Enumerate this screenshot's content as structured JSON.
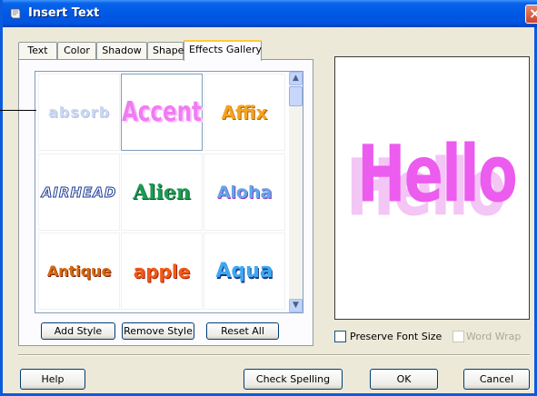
{
  "window": {
    "title": "Insert Text"
  },
  "tabs": [
    {
      "label": "Text"
    },
    {
      "label": "Color"
    },
    {
      "label": "Shadow"
    },
    {
      "label": "Shape"
    },
    {
      "label": "Effects Gallery",
      "active": true
    }
  ],
  "gallery": {
    "items": [
      {
        "label": "absorb"
      },
      {
        "label": "Accent",
        "selected": true
      },
      {
        "label": "Affix"
      },
      {
        "label": "AIRHEAD"
      },
      {
        "label": "Alien"
      },
      {
        "label": "Aloha"
      },
      {
        "label": "Antique"
      },
      {
        "label": "apple"
      },
      {
        "label": "Aqua"
      }
    ]
  },
  "gallery_buttons": {
    "add_style": "Add Style",
    "remove_style": "Remove Style",
    "reset_all": "Reset All"
  },
  "preview": {
    "text": "Hello"
  },
  "options": {
    "preserve_font_size": {
      "label": "Preserve Font Size",
      "checked": false,
      "enabled": true
    },
    "word_wrap": {
      "label": "Word Wrap",
      "checked": false,
      "enabled": false
    }
  },
  "footer": {
    "help": "Help",
    "check_spelling": "Check Spelling",
    "ok": "OK",
    "cancel": "Cancel"
  },
  "colors": {
    "title_bar": "#0058E6",
    "dialog_bg": "#ECE9D8",
    "active_tab_highlight": "#FFC83C",
    "preview_main": "#EC5CEE",
    "preview_shadow": "#F3C6F6"
  }
}
